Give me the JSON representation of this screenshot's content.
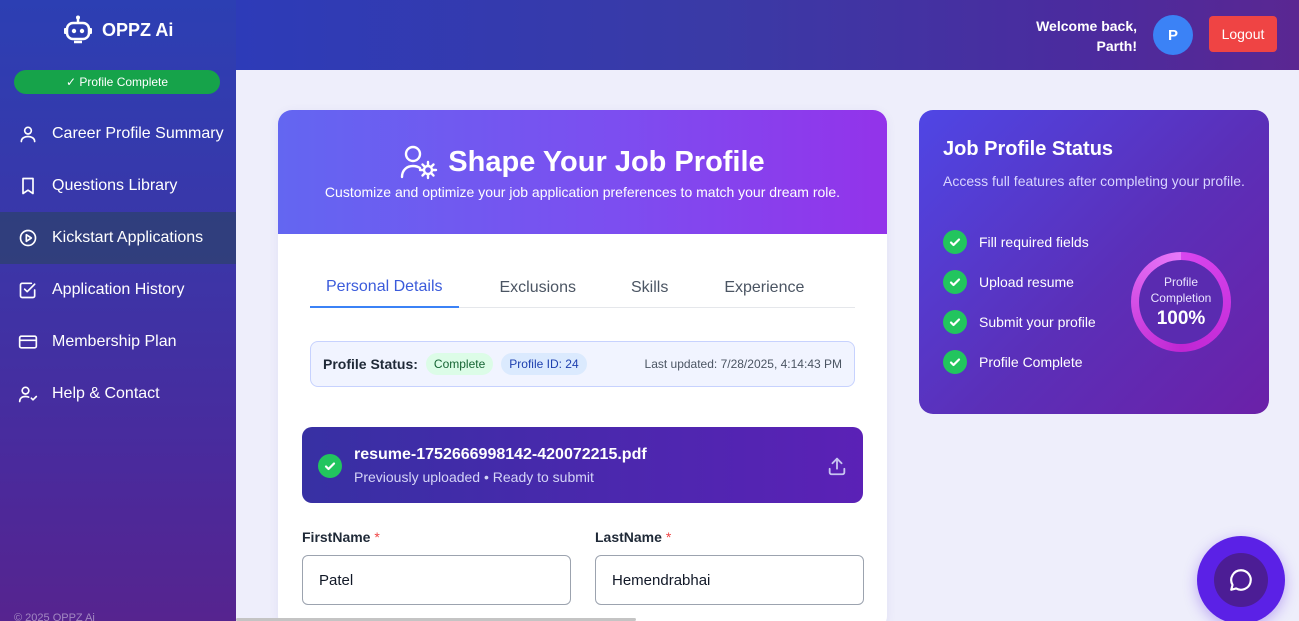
{
  "app": {
    "name": "OPPZ Ai"
  },
  "header": {
    "welcome_line1": "Welcome back,",
    "welcome_line2": "Parth!",
    "avatar_initial": "P",
    "logout_label": "Logout"
  },
  "sidebar": {
    "profile_badge": "✓ Profile Complete",
    "items": [
      {
        "label": "Career Profile Summary",
        "icon": "user-icon"
      },
      {
        "label": "Questions Library",
        "icon": "bookmark-icon"
      },
      {
        "label": "Kickstart Applications",
        "icon": "play-circle-icon",
        "active": true
      },
      {
        "label": "Application History",
        "icon": "check-square-icon"
      },
      {
        "label": "Membership Plan",
        "icon": "credit-card-icon"
      },
      {
        "label": "Help & Contact",
        "icon": "user-check-icon"
      }
    ],
    "copyright": "© 2025 OPPZ Ai"
  },
  "main": {
    "title": "Shape Your Job Profile",
    "subtitle": "Customize and optimize your job application preferences to match your dream role.",
    "tabs": [
      {
        "label": "Personal Details",
        "active": true
      },
      {
        "label": "Exclusions"
      },
      {
        "label": "Skills"
      },
      {
        "label": "Experience"
      }
    ],
    "status": {
      "label": "Profile Status:",
      "state": "Complete",
      "profile_id": "Profile ID: 24",
      "last_updated": "Last updated: 7/28/2025, 4:14:43 PM"
    },
    "resume": {
      "filename": "resume-1752666998142-420072215.pdf",
      "note": "Previously uploaded • Ready to submit"
    },
    "form": {
      "first_name_label": "FirstName",
      "first_name_value": "Patel",
      "last_name_label": "LastName",
      "last_name_value": "Hemendrabhai",
      "required_mark": "*"
    }
  },
  "status_card": {
    "title": "Job Profile Status",
    "subtitle": "Access full features after completing your profile.",
    "checklist": [
      "Fill required fields",
      "Upload resume",
      "Submit your profile",
      "Profile Complete"
    ],
    "completion_label_1": "Profile",
    "completion_label_2": "Completion",
    "completion_value": "100%",
    "completion_fraction": 1.0
  },
  "colors": {
    "accent": "#6366f1",
    "success": "#22c55e",
    "danger": "#ef4444"
  }
}
